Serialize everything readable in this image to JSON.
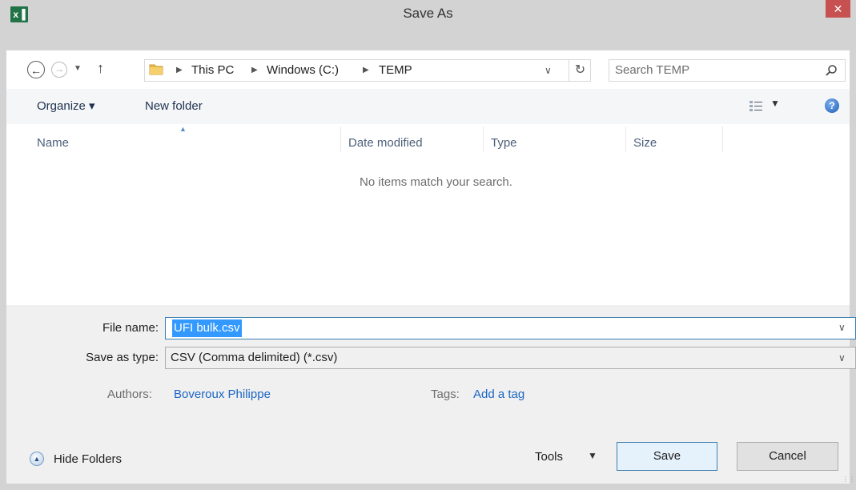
{
  "window": {
    "title": "Save As",
    "app_icon_label": "x▐",
    "close_label": "✕"
  },
  "nav": {
    "breadcrumbs": [
      "This PC",
      "Windows (C:)",
      "TEMP"
    ],
    "search_placeholder": "Search TEMP"
  },
  "commands": {
    "organize": "Organize ▾",
    "new_folder": "New folder"
  },
  "columns": [
    "Name",
    "Date modified",
    "Type",
    "Size"
  ],
  "file_list": {
    "empty_message": "No items match your search."
  },
  "form": {
    "file_name_label": "File name:",
    "file_name_value": "UFI bulk.csv",
    "save_type_label": "Save as type:",
    "save_type_value": "CSV (Comma delimited) (*.csv)",
    "authors_label": "Authors:",
    "authors_value": "Boveroux Philippe",
    "tags_label": "Tags:",
    "tags_value": "Add a tag"
  },
  "footer": {
    "hide_folders": "Hide Folders",
    "tools": "Tools",
    "save": "Save",
    "cancel": "Cancel"
  },
  "colors": {
    "accent": "#3399ff",
    "link": "#1a66c4",
    "close": "#c75050"
  }
}
